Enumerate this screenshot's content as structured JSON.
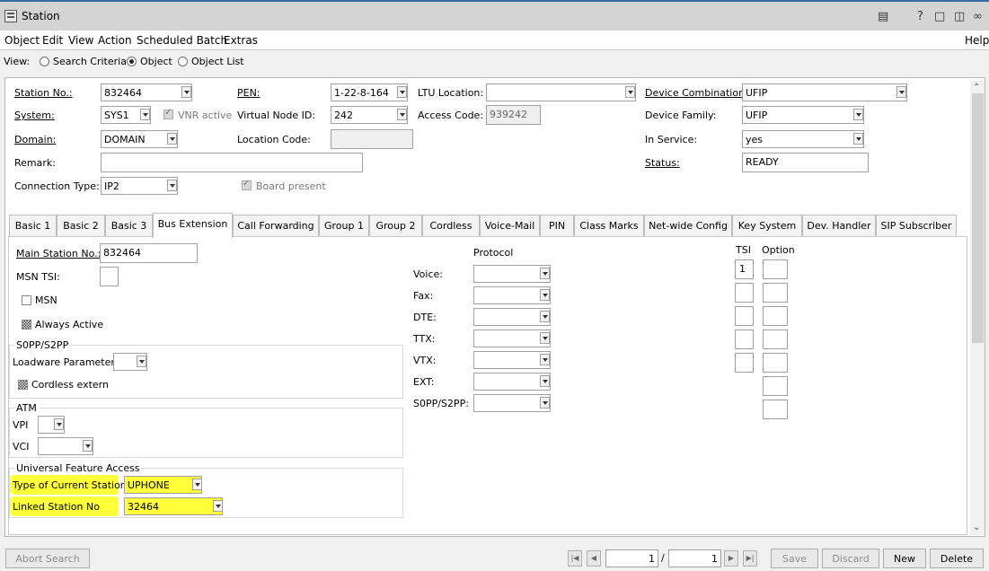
{
  "window": {
    "title": "Station"
  },
  "menu": [
    "Object",
    "Edit",
    "View",
    "Action",
    "Scheduled Batch",
    "Extras"
  ],
  "help": "Help",
  "view": {
    "label": "View:",
    "options": [
      "Search Criteria",
      "Object",
      "Object List"
    ],
    "selected": "Object"
  },
  "form": {
    "station_no_label": "Station No.:",
    "station_no": "832464",
    "pen_label": "PEN:",
    "pen": "1-22-8-164",
    "ltu_label": "LTU Location:",
    "ltu": "",
    "device_comb_label": "Device Combination:",
    "device_comb": "UFIP",
    "system_label": "System:",
    "system": "SYS1",
    "vnr_label": "VNR active",
    "vnode_label": "Virtual Node ID:",
    "vnode": "242",
    "access_label": "Access Code:",
    "access": "939242",
    "device_family_label": "Device Family:",
    "device_family": "UFIP",
    "domain_label": "Domain:",
    "domain": "DOMAIN",
    "location_label": "Location Code:",
    "location": "",
    "in_service_label": "In Service:",
    "in_service": "yes",
    "remark_label": "Remark:",
    "remark": "",
    "status_label": "Status:",
    "status": "READY",
    "conn_type_label": "Connection Type:",
    "conn_type": "IP2",
    "board_label": "Board present"
  },
  "tabs": [
    "Basic 1",
    "Basic 2",
    "Basic 3",
    "Bus Extension",
    "Call Forwarding",
    "Group 1",
    "Group 2",
    "Cordless",
    "Voice-Mail",
    "PIN",
    "Class Marks",
    "Net-wide Config",
    "Key System",
    "Dev. Handler",
    "SIP Subscriber"
  ],
  "bus": {
    "main_station_label": "Main Station No.:",
    "main_station": "832464",
    "msn_tsi_label": "MSN TSI:",
    "msn_tsi": "",
    "msn_label": "MSN",
    "always_active_label": "Always Active",
    "s0pp_group": "S0PP/S2PP",
    "loadware_label": "Loadware Parameter",
    "cordless_extern_label": "Cordless extern",
    "atm_group": "ATM",
    "vpi_label": "VPI",
    "vci_label": "VCI",
    "ufa_group": "Universal Feature Access",
    "type_current_label": "Type of Current Station",
    "type_current": "UPHONE",
    "linked_label": "Linked Station No",
    "linked": "32464",
    "protocol_header": "Protocol",
    "protocol_rows": [
      "Voice:",
      "Fax:",
      "DTE:",
      "TTX:",
      "VTX:",
      "EXT:",
      "S0PP/S2PP:"
    ],
    "tsi_header": "TSI",
    "option_header": "Option",
    "tsi_first": "1"
  },
  "footer": {
    "abort": "Abort Search",
    "page_current": "1",
    "page_sep": "/",
    "page_total": "1",
    "save": "Save",
    "discard": "Discard",
    "new": "New",
    "delete": "Delete"
  },
  "icons": [
    "station-icon",
    "document-icon",
    "help-icon",
    "folder-icon",
    "exit-icon",
    "link-icon"
  ]
}
